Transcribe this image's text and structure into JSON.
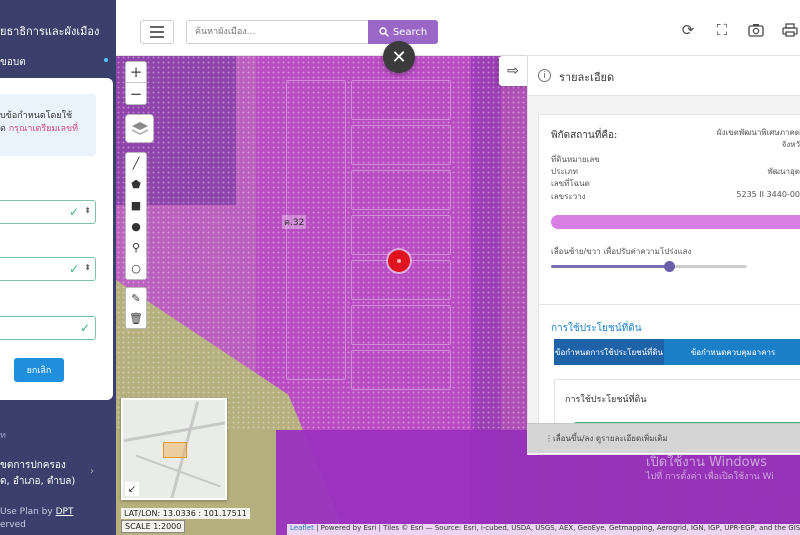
{
  "sidebar": {
    "title": "ยธาธิการและผังเมือง",
    "subtitle": "ขอบต",
    "note_line1": "บข้อกำหนดโดยใช้",
    "note_line2": "ด",
    "note_hint": "กรุณาเตรียมเลขที่",
    "submit_label": "ยกเลิก",
    "small_label": "ท",
    "section_line1": "ขตการปกครอง",
    "section_line2": "ด, อำเภอ, ตำบล)",
    "footer_line1": "Use Plan by",
    "footer_link": "DPT",
    "footer_line2": "erved"
  },
  "topbar": {
    "search_placeholder": "ค้นหาผังเมือง...",
    "search_label": "Search"
  },
  "map": {
    "parcel_label": "ค.32",
    "coords": "LAT/LON: 13.0336 : 101.17511",
    "scale": "SCALE 1:2000",
    "attribution_link": "Leaflet",
    "attribution_text": "| Powered by Esri | Tiles © Esri — Source: Esri, i-cubed, USDA, USGS, AEX, GeoEye, Getmapping, Aerogrid, IGN, IGP, UPR-EGP, and the GIS",
    "watermark_line1": "เปิดใช้งาน Windows",
    "watermark_line2": "ไปที่ การตั้งค่า เพื่อเปิดใช้งาน Wi"
  },
  "panel": {
    "title": "รายละเอียด",
    "location_label": "พิกัดสถานที่คือ:",
    "location_value1": "ผังเขตพัฒนาพิเศษภาคต",
    "location_value2": "จังหวั",
    "rows": [
      {
        "label": "ที่ดินหมายเลข",
        "value": ""
      },
      {
        "label": "ประเภท",
        "value": "พัฒนาอุต"
      },
      {
        "label": "เลขที่โฉนด",
        "value": ""
      },
      {
        "label": "เลขระวาง",
        "value": "5235 II 3440-00"
      }
    ],
    "slider_label": "เลื่อนซ้าย/ขวา เพื่อปรับค่าความโปร่งแสง",
    "slider_value": 0.6,
    "landuse_title": "การใช้ประโยชน์ที่ดิน",
    "tab1_label": "ข้อกำหนดการใช้ประโยชน์ที่ดิน",
    "tab2_label": "ข้อกำหนดควบคุมอาคาร",
    "sub_title": "การใช้ประโยชน์ที่ดิน",
    "expand_label": "เลื่อนขึ้น/ลง ดูรายละเอียดเพิ่มเติม"
  },
  "colors": {
    "search_button": "#9a67c7",
    "zone_violet": "#c35dc9",
    "zone_purple": "#9a2ec0",
    "marker": "#e0141e",
    "tab_active": "#1e63a8"
  }
}
